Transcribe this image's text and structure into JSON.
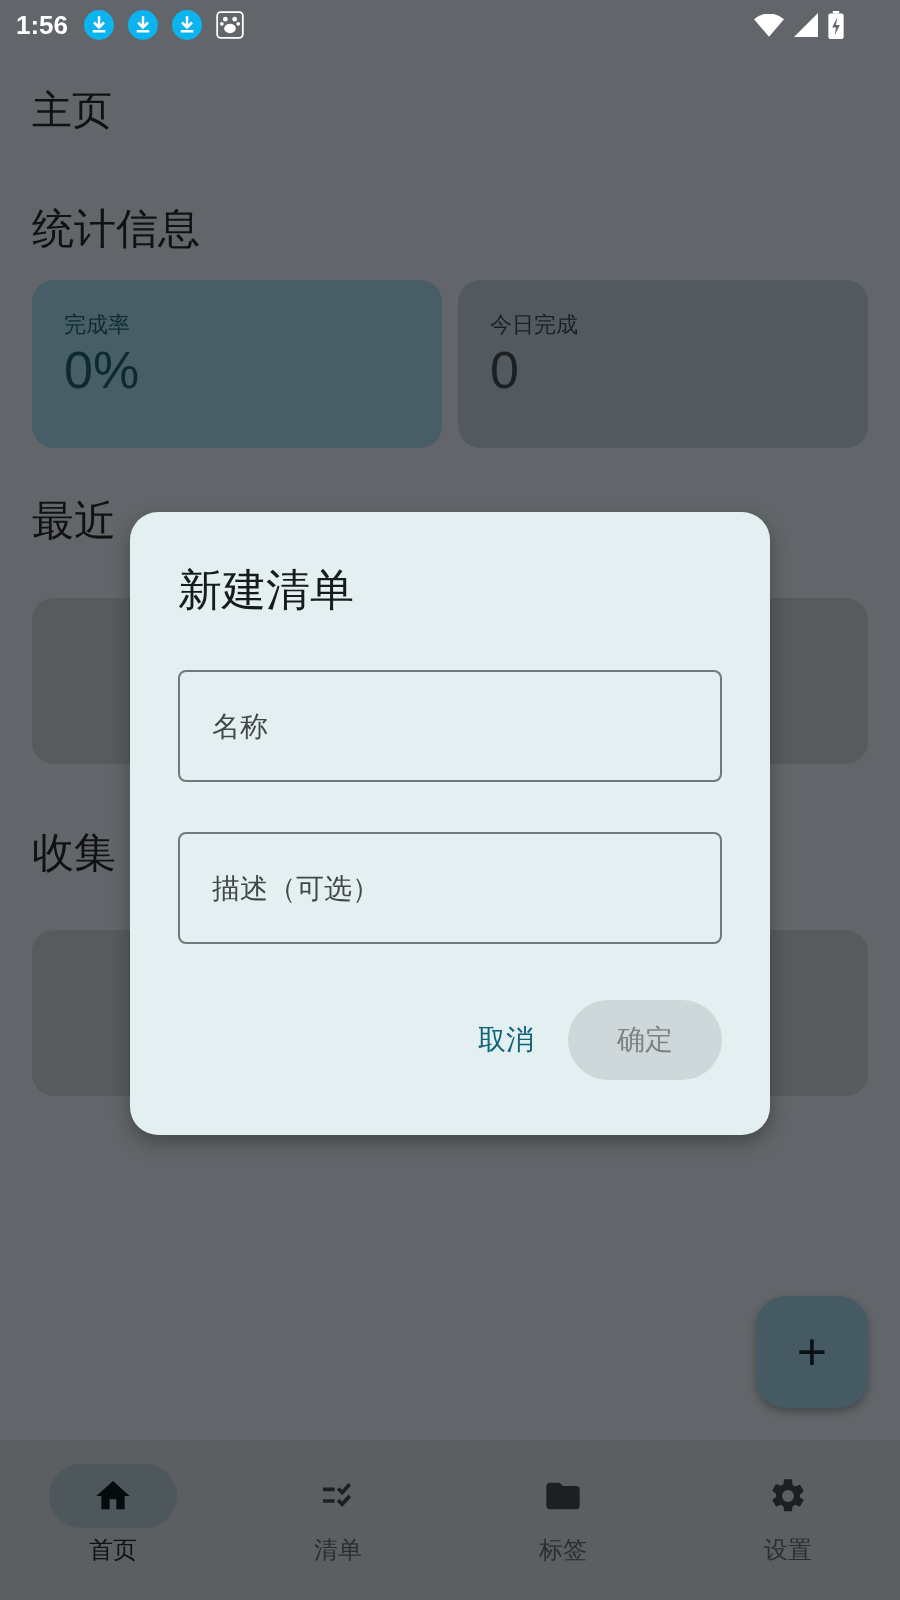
{
  "status_bar": {
    "time": "1:56",
    "notifications": [
      {
        "kind": "download"
      },
      {
        "kind": "download"
      },
      {
        "kind": "download"
      },
      {
        "kind": "paw"
      }
    ]
  },
  "page_title": "主页",
  "stats": {
    "heading": "统计信息",
    "cards": [
      {
        "label": "完成率",
        "value": "0%",
        "accent": true
      },
      {
        "label": "今日完成",
        "value": "0",
        "accent": false
      }
    ]
  },
  "recent": {
    "heading": "最近"
  },
  "collections": {
    "heading": "收集"
  },
  "dialog": {
    "title": "新建清单",
    "fields": [
      {
        "placeholder": "名称"
      },
      {
        "placeholder": "描述（可选）"
      }
    ],
    "cancel": "取消",
    "confirm": {
      "label": "确定",
      "disabled": true
    }
  },
  "fab": "+",
  "nav": [
    {
      "label": "首页",
      "kind": "home",
      "selected": true
    },
    {
      "label": "清单",
      "kind": "checklist",
      "selected": false
    },
    {
      "label": "标签",
      "kind": "folder",
      "selected": false
    },
    {
      "label": "设置",
      "kind": "gear",
      "selected": false
    }
  ]
}
